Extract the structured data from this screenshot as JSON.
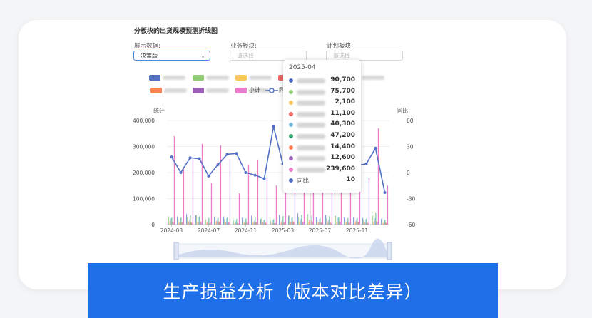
{
  "header": {
    "title": "分板块的出货规模预测折线图",
    "display_label": "展示数据:",
    "display_value": "决策版",
    "business_label": "业务板块:",
    "business_placeholder": "请选择",
    "plan_label": "计划板块:",
    "plan_placeholder": "请选择"
  },
  "legend": [
    {
      "color": "#5470c6",
      "text": ""
    },
    {
      "color": "#91cc75",
      "text": ""
    },
    {
      "color": "#fac858",
      "text": ""
    },
    {
      "color": "#ee6666",
      "text": ""
    },
    {
      "color": "#3ba272",
      "text": ""
    },
    {
      "color": "#fc8452",
      "text": ""
    },
    {
      "color": "#9a60b4",
      "text": ""
    },
    {
      "color": "#ea7ccc",
      "text": ""
    },
    {
      "color": "#ea7ccc",
      "text": "小计"
    },
    {
      "color": "#5470c6",
      "text": "同"
    }
  ],
  "tooltip": {
    "title": "2025-04",
    "rows": [
      {
        "color": "#5470c6",
        "name": "",
        "value": "90,700"
      },
      {
        "color": "#91cc75",
        "name": "",
        "value": "75,700"
      },
      {
        "color": "#fac858",
        "name": "",
        "value": "2,100"
      },
      {
        "color": "#ee6666",
        "name": "",
        "value": "11,100"
      },
      {
        "color": "#73c0de",
        "name": "",
        "value": "40,300"
      },
      {
        "color": "#3ba272",
        "name": "",
        "value": "47,200"
      },
      {
        "color": "#fc8452",
        "name": "",
        "value": "14,400"
      },
      {
        "color": "#9a60b4",
        "name": "",
        "value": "12,600"
      },
      {
        "color": "#ea7ccc",
        "name": "",
        "value": "239,600"
      },
      {
        "color": "#5470c6",
        "name": "同比",
        "value": "10"
      }
    ]
  },
  "banner": {
    "text": "生产损益分析（版本对比差异）"
  },
  "chart_data": {
    "type": "bar",
    "ylabel": "统计",
    "y2label": "同比",
    "ylim": [
      0,
      400000
    ],
    "y2lim": [
      -60,
      60
    ],
    "yticks": [
      "400,000",
      "300,000",
      "200,000",
      "100,000",
      "0"
    ],
    "y2ticks": [
      "60",
      "30",
      "0",
      "-30",
      "-60"
    ],
    "xticks": [
      "2024-03",
      "2024-07",
      "2024-11",
      "2025-03",
      "2025-07",
      "2025-11"
    ],
    "n_months": 24,
    "subtotal": [
      340000,
      220000,
      250000,
      310000,
      160000,
      305000,
      250000,
      120000,
      230000,
      250000,
      180000,
      150000,
      230000,
      300000,
      320000,
      239600,
      190000,
      250000,
      280000,
      160000,
      260000,
      180000,
      370000,
      150000
    ],
    "other_series_max": [
      70000,
      60000,
      65000,
      75000,
      50000,
      70000,
      60000,
      40000,
      55000,
      60000,
      50000,
      45000,
      60000,
      70000,
      75000,
      90700,
      55000,
      60000,
      70000,
      50000,
      65000,
      50000,
      80000,
      45000
    ],
    "yoy": [
      18,
      0,
      17,
      16,
      -4,
      9,
      21,
      22,
      0,
      -3,
      -7,
      53,
      10,
      15,
      20,
      10,
      7,
      6,
      10,
      5,
      8,
      10,
      28,
      -23
    ]
  }
}
